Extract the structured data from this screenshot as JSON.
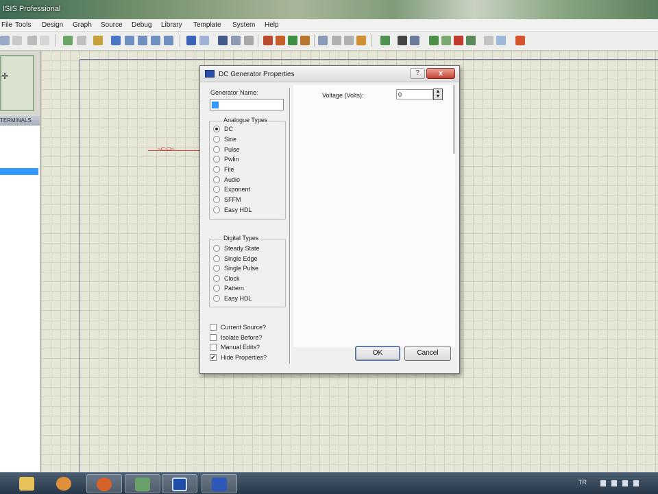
{
  "window": {
    "title": "ISIS Professional"
  },
  "menu": [
    "File",
    "Tools",
    "Design",
    "Graph",
    "Source",
    "Debug",
    "Library",
    "Template",
    "System",
    "Help"
  ],
  "left_panel": {
    "terminals_header": "TERMINALS"
  },
  "dialog": {
    "title": "DC Generator Properties",
    "help_label": "?",
    "close_label": "x",
    "generator_name_label": "Generator Name:",
    "generator_name_value": "",
    "analogue_types": {
      "title": "Analogue Types",
      "options": [
        {
          "label": "DC",
          "selected": true
        },
        {
          "label": "Sine",
          "selected": false
        },
        {
          "label": "Pulse",
          "selected": false
        },
        {
          "label": "Pwlin",
          "selected": false
        },
        {
          "label": "File",
          "selected": false
        },
        {
          "label": "Audio",
          "selected": false
        },
        {
          "label": "Exponent",
          "selected": false
        },
        {
          "label": "SFFM",
          "selected": false
        },
        {
          "label": "Easy HDL",
          "selected": false
        }
      ]
    },
    "digital_types": {
      "title": "Digital Types",
      "options": [
        {
          "label": "Steady State",
          "selected": false
        },
        {
          "label": "Single Edge",
          "selected": false
        },
        {
          "label": "Single Pulse",
          "selected": false
        },
        {
          "label": "Clock",
          "selected": false
        },
        {
          "label": "Pattern",
          "selected": false
        },
        {
          "label": "Easy HDL",
          "selected": false
        }
      ]
    },
    "checkboxes": [
      {
        "label": "Current Source?",
        "checked": false
      },
      {
        "label": "Isolate Before?",
        "checked": false
      },
      {
        "label": "Manual Edits?",
        "checked": false
      },
      {
        "label": "Hide Properties?",
        "checked": true
      }
    ],
    "voltage_label": "Voltage (Volts):",
    "voltage_value": "0",
    "ok_label": "OK",
    "cancel_label": "Cancel"
  },
  "taskbar": {
    "tray_language": "TR"
  },
  "icons": [
    "app-icon",
    "windows-explorer-icon",
    "media-player-icon",
    "firefox-icon",
    "network-icon",
    "ares-icon",
    "isis-icon"
  ]
}
